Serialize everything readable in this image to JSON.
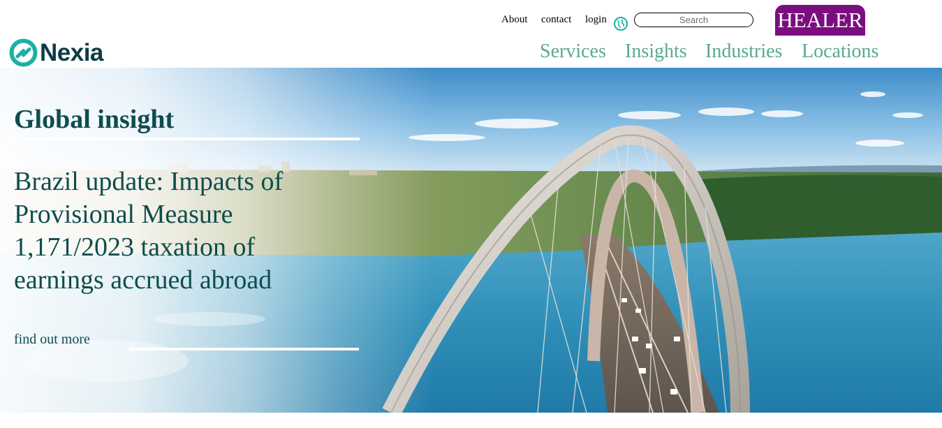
{
  "brand": {
    "name": "Nexia",
    "primary_color": "#0e3b44",
    "accent_color": "#1bb1a4"
  },
  "utility_nav": {
    "about": "About",
    "contact": "contact",
    "login": "login",
    "globe_icon": "globe-icon"
  },
  "search": {
    "placeholder": "Search",
    "value": ""
  },
  "healer_button": {
    "label": "HEALER",
    "color": "#7b0e7f"
  },
  "main_nav": {
    "color": "#5aa892",
    "items": [
      "Services",
      "Insights",
      "Industries",
      "Locations"
    ]
  },
  "hero": {
    "kicker": "Global insight",
    "headline": "Brazil update: Impacts of Provisional Measure 1,171/2023 taxation of earnings accrued abroad",
    "cta": "find out more",
    "text_color": "#0e4d4e"
  }
}
